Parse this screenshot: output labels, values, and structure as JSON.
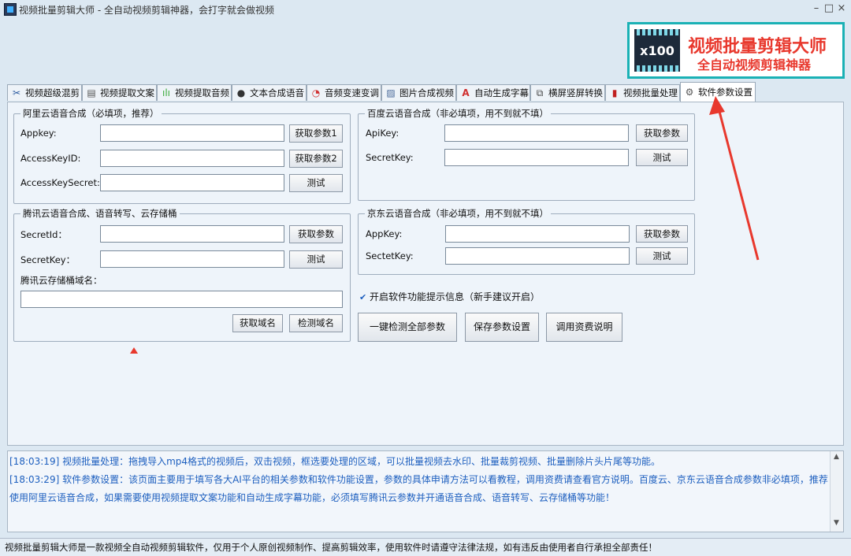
{
  "window": {
    "title": "视频批量剪辑大师 - 全自动视频剪辑神器，会打字就会做视频",
    "controls": [
      "–",
      "□",
      "×"
    ]
  },
  "banner": {
    "badge": "x100",
    "title": "视频批量剪辑大师",
    "subtitle": "全自动视频剪辑神器"
  },
  "tabs": [
    {
      "label": "视频超级混剪",
      "icon": "scissors-icon"
    },
    {
      "label": "视频提取文案",
      "icon": "document-icon"
    },
    {
      "label": "视频提取音频",
      "icon": "audio-wave-icon"
    },
    {
      "label": "文本合成语音",
      "icon": "microphone-icon"
    },
    {
      "label": "音频变速变调",
      "icon": "speed-gauge-icon"
    },
    {
      "label": "图片合成视频",
      "icon": "image-icon"
    },
    {
      "label": "自动生成字幕",
      "icon": "subtitle-icon"
    },
    {
      "label": "横屏竖屏转换",
      "icon": "rotate-screen-icon"
    },
    {
      "label": "视频批量处理",
      "icon": "film-icon"
    },
    {
      "label": "软件参数设置",
      "icon": "gear-icon"
    }
  ],
  "aliyun": {
    "legend": "阿里云语音合成（必填项，推荐）",
    "appkey_label": "Appkey:",
    "accesskeyid_label": "AccessKeyID:",
    "accesskeysecret_label": "AccessKeySecret:",
    "get_param1": "获取参数1",
    "get_param2": "获取参数2",
    "test": "测试"
  },
  "baidu": {
    "legend": "百度云语音合成（非必填项，用不到就不填）",
    "apikey_label": "ApiKey:",
    "secretkey_label": "SecretKey:",
    "get_param": "获取参数",
    "test": "测试"
  },
  "tencent": {
    "legend": "腾讯云语音合成、语音转写、云存储桶",
    "secretid_label": "SecretId：",
    "secretkey_label": "SecretKey：",
    "bucket_label": "腾讯云存储桶域名：",
    "get_param": "获取参数",
    "test": "测试",
    "get_domain": "获取域名",
    "check_domain": "检测域名"
  },
  "jd": {
    "legend": "京东云语音合成（非必填项，用不到就不填）",
    "appkey_label": "AppKey:",
    "sectetkey_label": "SectetKey:",
    "get_param": "获取参数",
    "test": "测试"
  },
  "tips_checkbox": {
    "mark": "✔",
    "label": "开启软件功能提示信息（新手建议开启）"
  },
  "actions": {
    "check_all": "一键检测全部参数",
    "save": "保存参数设置",
    "fee_info": "调用资费说明"
  },
  "log": {
    "lines": [
      "[18:03:19] 视频批量处理：拖拽导入mp4格式的视频后，双击视频，框选要处理的区域，可以批量视频去水印、批量裁剪视频、批量删除片头片尾等功能。",
      "[18:03:29] 软件参数设置：该页面主要用于填写各大AI平台的相关参数和软件功能设置，参数的具体申请方法可以看教程，调用资费请查看官方说明。百度云、京东云语音合成参数非必填项，推荐",
      "使用阿里云语音合成，如果需要使用视频提取文案功能和自动生成字幕功能，必须填写腾讯云参数并开通语音合成、语音转写、云存储桶等功能！"
    ]
  },
  "status": {
    "text": "视频批量剪辑大师是一款视频全自动视频剪辑软件，仅用于个人原创视频制作、提高剪辑效率，使用软件时请遵守法律法规，如有违反由使用者自行承担全部责任！"
  },
  "colors": {
    "banner_red": "#e8382d",
    "banner_border": "#1ab1b5",
    "log_text": "#1d5fbf",
    "arrow": "#e8382d"
  }
}
